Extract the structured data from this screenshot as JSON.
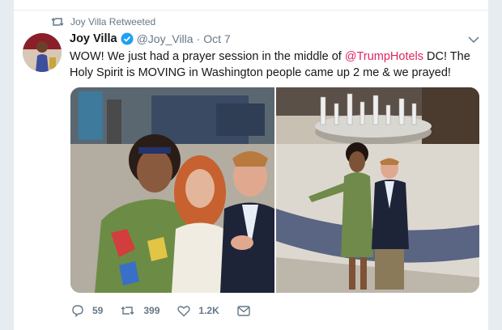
{
  "retweet_banner": {
    "text": "Joy Villa Retweeted",
    "icon": "retweet-icon"
  },
  "tweet": {
    "display_name": "Joy Villa",
    "verified": true,
    "handle": "@Joy_Villa",
    "separator": "·",
    "date": "Oct 7",
    "text_part1": "WOW! We just had a prayer session in the middle of ",
    "mention": "@TrumpHotels",
    "text_part2": " DC! The Holy Spirit is MOVING in Washington people came up 2 me & we prayed!",
    "mention_color": "#e0245e"
  },
  "actions": {
    "replies": "59",
    "retweets": "399",
    "likes": "1.2K"
  },
  "colors": {
    "verified": "#1da1f2",
    "retweeted": "#17bf63",
    "muted": "#657786"
  }
}
